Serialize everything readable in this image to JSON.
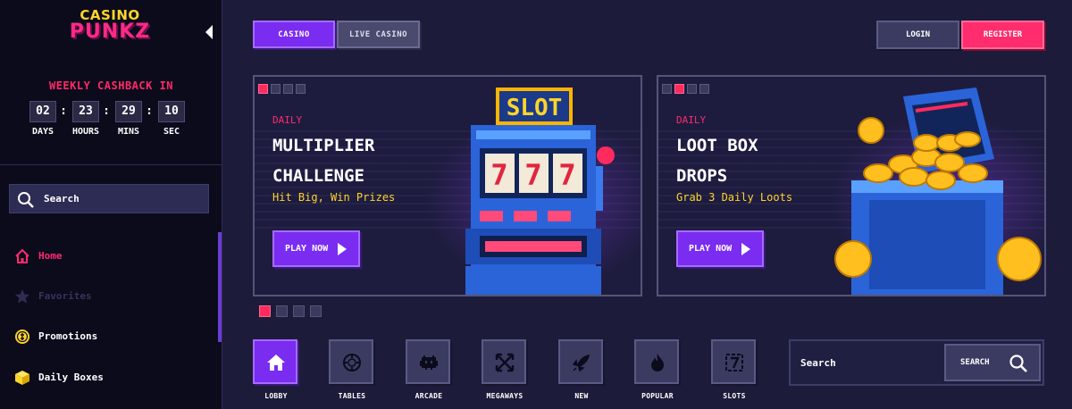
{
  "brand": {
    "line1": "CASINO",
    "line2": "PUNKZ"
  },
  "cashback": {
    "title": "WEEKLY CASHBACK IN",
    "timer": [
      {
        "value": "02",
        "label": "DAYS"
      },
      {
        "value": "23",
        "label": "HOURS"
      },
      {
        "value": "29",
        "label": "MINS"
      },
      {
        "value": "10",
        "label": "SEC"
      }
    ]
  },
  "sidebar": {
    "search_placeholder": "Search",
    "items": [
      {
        "label": "Home",
        "icon": "home-icon",
        "color": "#ff2a6e"
      },
      {
        "label": "Favorites",
        "icon": "star-icon",
        "color": "#3b3b62"
      },
      {
        "label": "Promotions",
        "icon": "coin-icon",
        "color": "#ffffff"
      },
      {
        "label": "Daily Boxes",
        "icon": "box-icon",
        "color": "#ffffff"
      }
    ]
  },
  "header": {
    "tabs": [
      {
        "label": "CASINO"
      },
      {
        "label": "LIVE CASINO"
      }
    ],
    "login_label": "LOGIN",
    "register_label": "REGISTER"
  },
  "banners": [
    {
      "subtitle": "DAILY",
      "title_line1": "MULTIPLIER",
      "title_line2": "CHALLENGE",
      "description": "Hit Big, Win Prizes",
      "button": "PLAY NOW",
      "art_text": "SLOT",
      "reels": [
        "7",
        "7",
        "7"
      ]
    },
    {
      "subtitle": "DAILY",
      "title_line1": "LOOT BOX",
      "title_line2": "DROPS",
      "description": "Grab 3 Daily Loots",
      "button": "PLAY NOW"
    }
  ],
  "categories": [
    {
      "label": "LOBBY",
      "icon": "home-icon"
    },
    {
      "label": "TABLES",
      "icon": "chip-icon"
    },
    {
      "label": "ARCADE",
      "icon": "invader-icon"
    },
    {
      "label": "MEGAWAYS",
      "icon": "arrows-icon"
    },
    {
      "label": "NEW",
      "icon": "rocket-icon"
    },
    {
      "label": "POPULAR",
      "icon": "fire-icon"
    },
    {
      "label": "SLOTS",
      "icon": "slot-icon"
    }
  ],
  "game_search": {
    "placeholder": "Search",
    "button": "SEARCH"
  },
  "colors": {
    "accent": "#7a2cf0",
    "pink": "#ff2d6d",
    "yellow": "#ffd42a",
    "bg": "#1c1b3a"
  }
}
